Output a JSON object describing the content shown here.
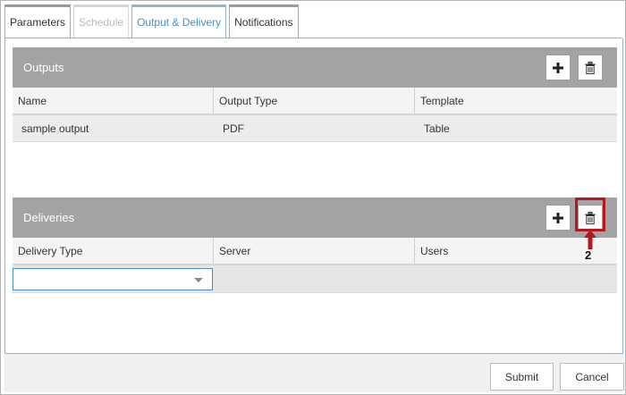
{
  "tabs": [
    {
      "label": "Parameters",
      "state": "normal"
    },
    {
      "label": "Schedule",
      "state": "disabled"
    },
    {
      "label": "Output & Delivery",
      "state": "active"
    },
    {
      "label": "Notifications",
      "state": "normal"
    }
  ],
  "outputs": {
    "title": "Outputs",
    "add_icon": "plus-icon",
    "delete_icon": "trash-icon",
    "columns": [
      "Name",
      "Output Type",
      "Template"
    ],
    "rows": [
      [
        "sample output",
        "PDF",
        "Table"
      ]
    ]
  },
  "deliveries": {
    "title": "Deliveries",
    "add_icon": "plus-icon",
    "delete_icon": "trash-icon",
    "columns": [
      "Delivery Type",
      "Server",
      "Users"
    ],
    "delivery_type_value": ""
  },
  "callout": {
    "number": "2",
    "color": "#b3191e"
  },
  "footer": {
    "submit_label": "Submit",
    "cancel_label": "Cancel"
  },
  "colors": {
    "active_tab": "#4a8ec7",
    "section_header": "#a3a3a3"
  }
}
